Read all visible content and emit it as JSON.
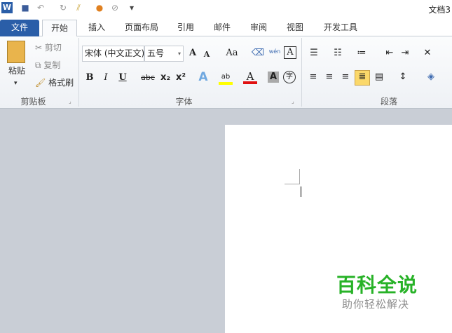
{
  "title_bar": {
    "doc_title": "文档3"
  },
  "quick_access": [
    "word-icon",
    "save-icon",
    "undo-icon",
    "redo-icon",
    "brush-icon",
    "color-icon",
    "eraser-icon",
    "customize-icon"
  ],
  "tabs": [
    {
      "label": "文件"
    },
    {
      "label": "开始"
    },
    {
      "label": "插入"
    },
    {
      "label": "页面布局"
    },
    {
      "label": "引用"
    },
    {
      "label": "邮件"
    },
    {
      "label": "审阅"
    },
    {
      "label": "视图"
    },
    {
      "label": "开发工具"
    }
  ],
  "clipboard": {
    "paste": "粘贴",
    "cut": "剪切",
    "copy": "复制",
    "format_painter": "格式刷",
    "label": "剪贴板"
  },
  "font": {
    "name": "宋体 (中文正文)",
    "size": "五号",
    "label": "字体",
    "grow": "A",
    "shrink": "A",
    "case": "Aa",
    "bold": "B",
    "italic": "I",
    "underline": "U",
    "strike": "abc",
    "sub": "x₂",
    "sup": "x²",
    "effects": "A",
    "highlight": "ab",
    "color": "A",
    "shade": "A",
    "enclose": "字",
    "pinyin": "wén",
    "border": "A"
  },
  "paragraph": {
    "label": "段落"
  },
  "watermark": {
    "title": "百科全说",
    "subtitle": "助你轻松解决"
  },
  "colors": {
    "file_tab": "#2a5ea8",
    "highlight": "#ffff00",
    "font_color": "#e01010",
    "watermark": "#27b227"
  }
}
